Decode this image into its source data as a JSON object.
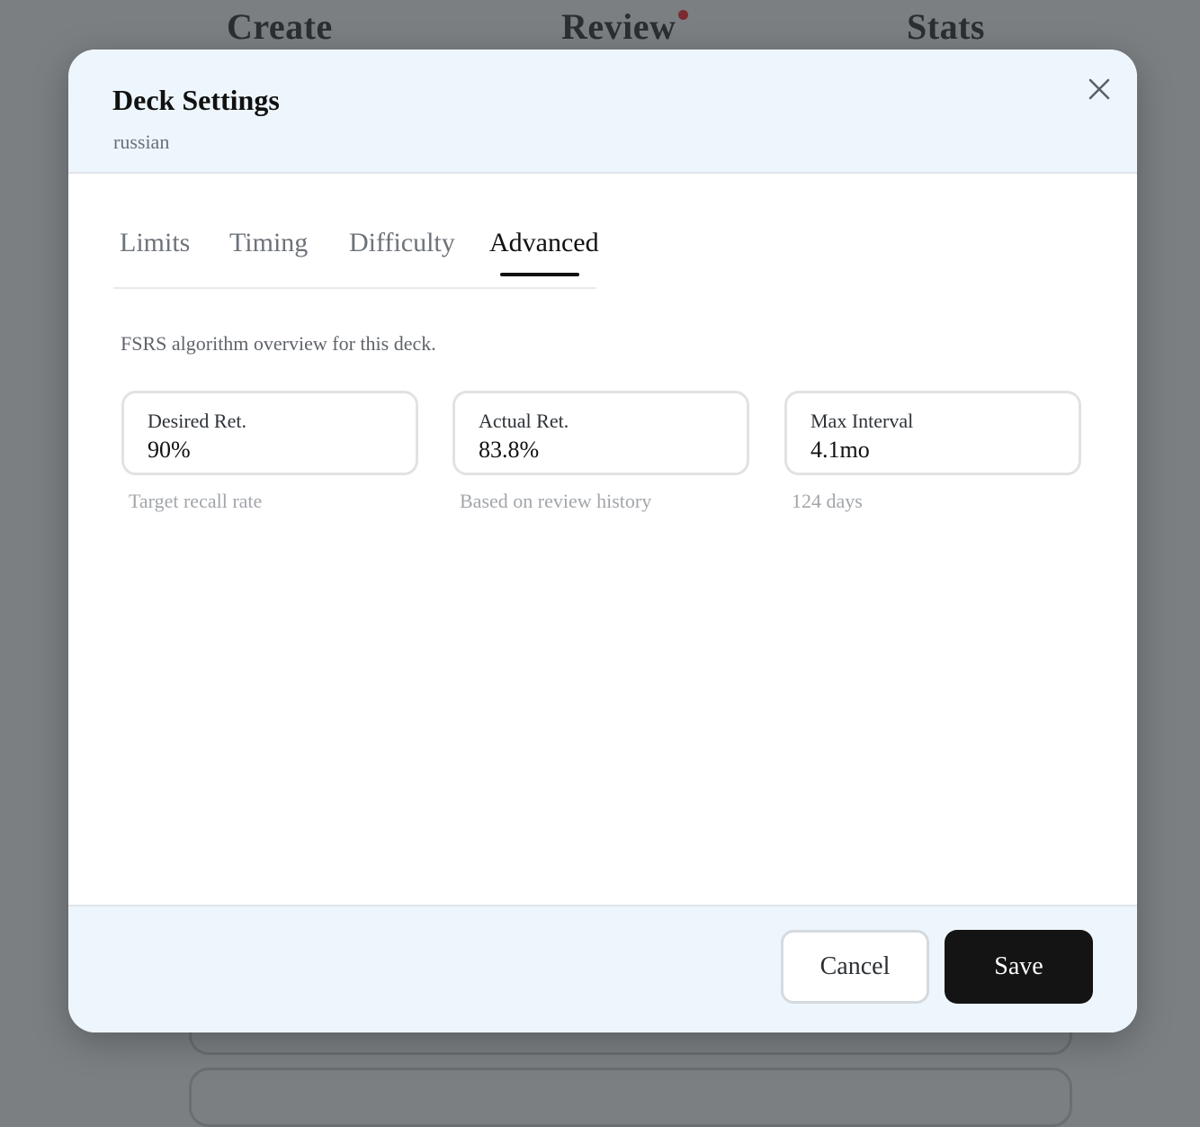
{
  "background_nav": {
    "items": [
      {
        "label": "Create"
      },
      {
        "label": "Review"
      },
      {
        "label": "Stats"
      }
    ]
  },
  "modal": {
    "title": "Deck Settings",
    "subtitle": "russian",
    "close_icon": "close-icon"
  },
  "tabs": [
    {
      "label": "Limits",
      "active": false
    },
    {
      "label": "Timing",
      "active": false
    },
    {
      "label": "Difficulty",
      "active": false
    },
    {
      "label": "Advanced",
      "active": true
    }
  ],
  "content": {
    "description": "FSRS algorithm overview for this deck.",
    "stats": [
      {
        "label": "Desired Ret.",
        "value": "90%",
        "note": "Target recall rate"
      },
      {
        "label": "Actual Ret.",
        "value": "83.8%",
        "note": "Based on review history"
      },
      {
        "label": "Max Interval",
        "value": "4.1mo",
        "note": "124 days"
      }
    ]
  },
  "footer": {
    "cancel_label": "Cancel",
    "save_label": "Save"
  },
  "colors": {
    "modal_header_bg": "#eef6fd",
    "overlay_bg": "#7b7f82",
    "primary_button": "#141414",
    "notification_dot": "#7a2b2f"
  }
}
